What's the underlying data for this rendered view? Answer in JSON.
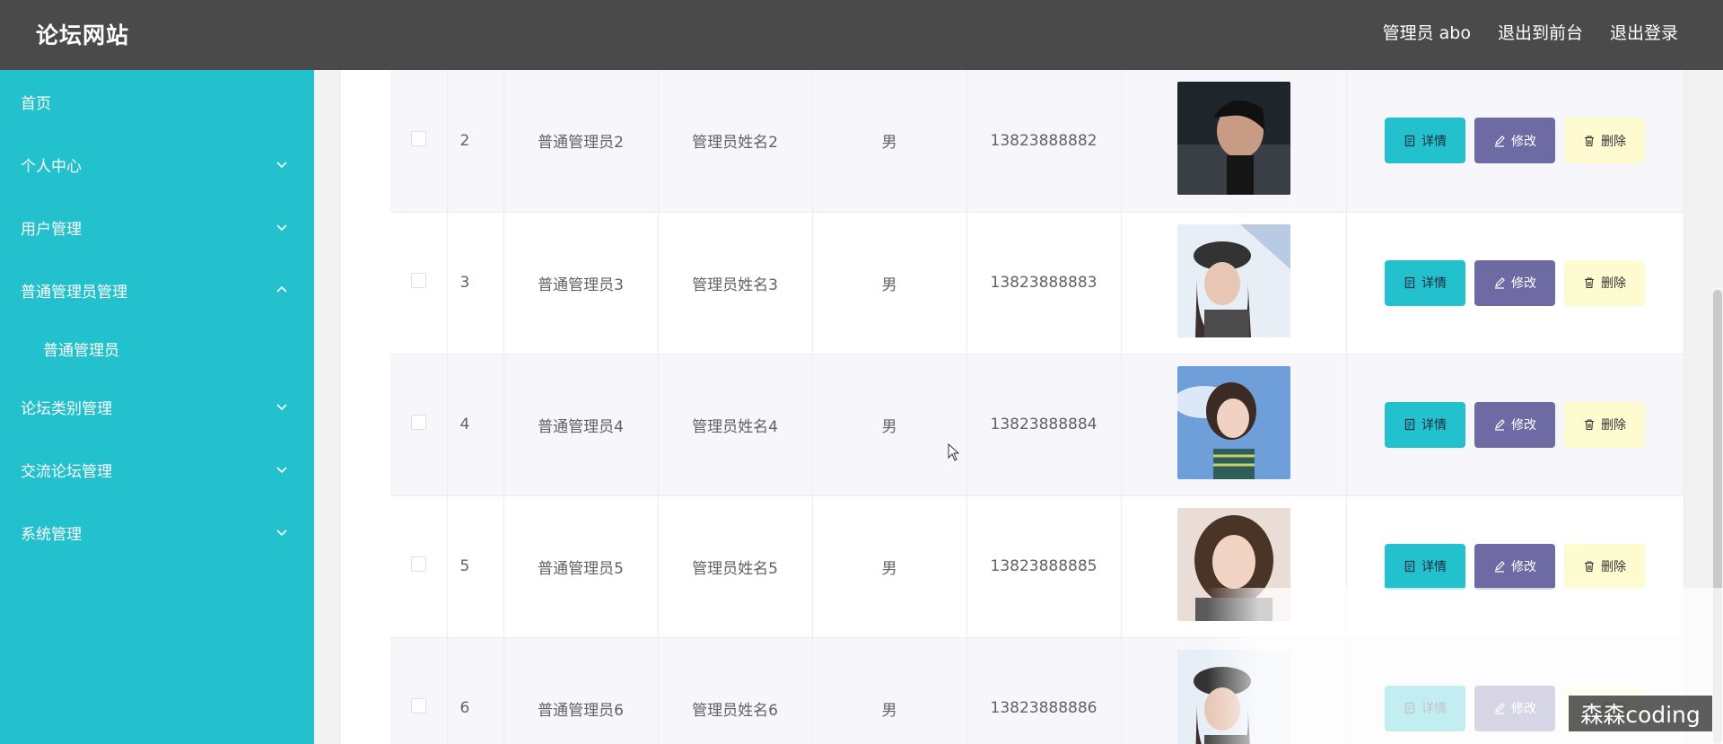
{
  "header": {
    "brand": "论坛网站",
    "admin_label": "管理员 abo",
    "to_front": "退出到前台",
    "logout": "退出登录"
  },
  "sidebar": {
    "items": [
      {
        "label": "首页"
      },
      {
        "label": "个人中心"
      },
      {
        "label": "用户管理"
      },
      {
        "label": "普通管理员管理"
      },
      {
        "label": "普通管理员"
      },
      {
        "label": "论坛类别管理"
      },
      {
        "label": "交流论坛管理"
      },
      {
        "label": "系统管理"
      }
    ]
  },
  "table": {
    "rows": [
      {
        "index": "2",
        "account": "普通管理员2",
        "name": "管理员姓名2",
        "gender": "男",
        "phone": "13823888882"
      },
      {
        "index": "3",
        "account": "普通管理员3",
        "name": "管理员姓名3",
        "gender": "男",
        "phone": "13823888883"
      },
      {
        "index": "4",
        "account": "普通管理员4",
        "name": "管理员姓名4",
        "gender": "男",
        "phone": "13823888884"
      },
      {
        "index": "5",
        "account": "普通管理员5",
        "name": "管理员姓名5",
        "gender": "男",
        "phone": "13823888885"
      },
      {
        "index": "6",
        "account": "普通管理员6",
        "name": "管理员姓名6",
        "gender": "男",
        "phone": "13823888886"
      }
    ],
    "actions": {
      "detail": "详情",
      "edit": "修改",
      "delete": "删除"
    }
  },
  "watermark": "森森coding",
  "colors": {
    "topbar": "#4a4a4a",
    "sidebar": "#23c0cd",
    "detail_button": "#23c0cd",
    "edit_button": "#6d6aa4",
    "delete_button": "#fffbd0"
  }
}
